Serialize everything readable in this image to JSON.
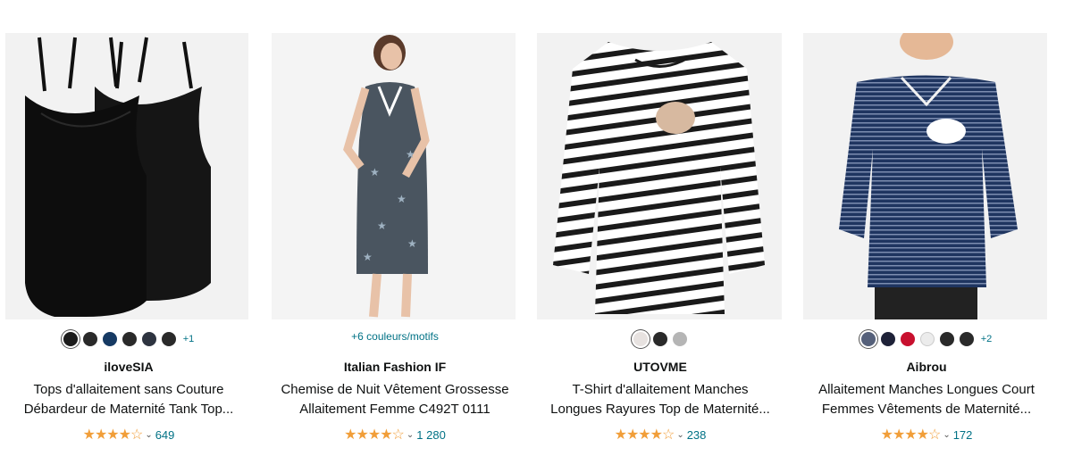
{
  "products": [
    {
      "brand": "iloveSIA",
      "title_line1": "Tops d'allaitement sans Couture",
      "title_line2": "Débardeur de Maternité Tank Top...",
      "stars": "★★★★☆",
      "chevron": "⌄",
      "reviews": "649",
      "swatches": [
        "#1b1b1b",
        "#2a2a2a",
        "#163a63",
        "#2a2a2a",
        "#2e3440",
        "#2a2a2a"
      ],
      "more_colors": "+1"
    },
    {
      "brand": "Italian Fashion IF",
      "title_line1": "Chemise de Nuit Vêtement Grossesse",
      "title_line2": "Allaitement Femme C492T 0111",
      "stars": "★★★★☆",
      "chevron": "⌄",
      "reviews": "1 280",
      "color_link": "+6 couleurs/motifs"
    },
    {
      "brand": "UTOVME",
      "title_line1": "T-Shirt d'allaitement Manches",
      "title_line2": "Longues Rayures Top de Maternité...",
      "stars": "★★★★☆",
      "chevron": "⌄",
      "reviews": "238",
      "swatches": [
        "#e7e2e0",
        "#2a2a2a",
        "#b5b5b5"
      ]
    },
    {
      "brand": "Aibrou",
      "title_line1": "Allaitement Manches Longues Court",
      "title_line2": "Femmes Vêtements de Maternité...",
      "stars": "★★★★☆",
      "chevron": "⌄",
      "reviews": "172",
      "swatches": [
        "#55607a",
        "#1e2238",
        "#c8102e",
        "#ececec",
        "#2a2a2a",
        "#2a2a2a"
      ],
      "more_colors": "+2"
    }
  ]
}
